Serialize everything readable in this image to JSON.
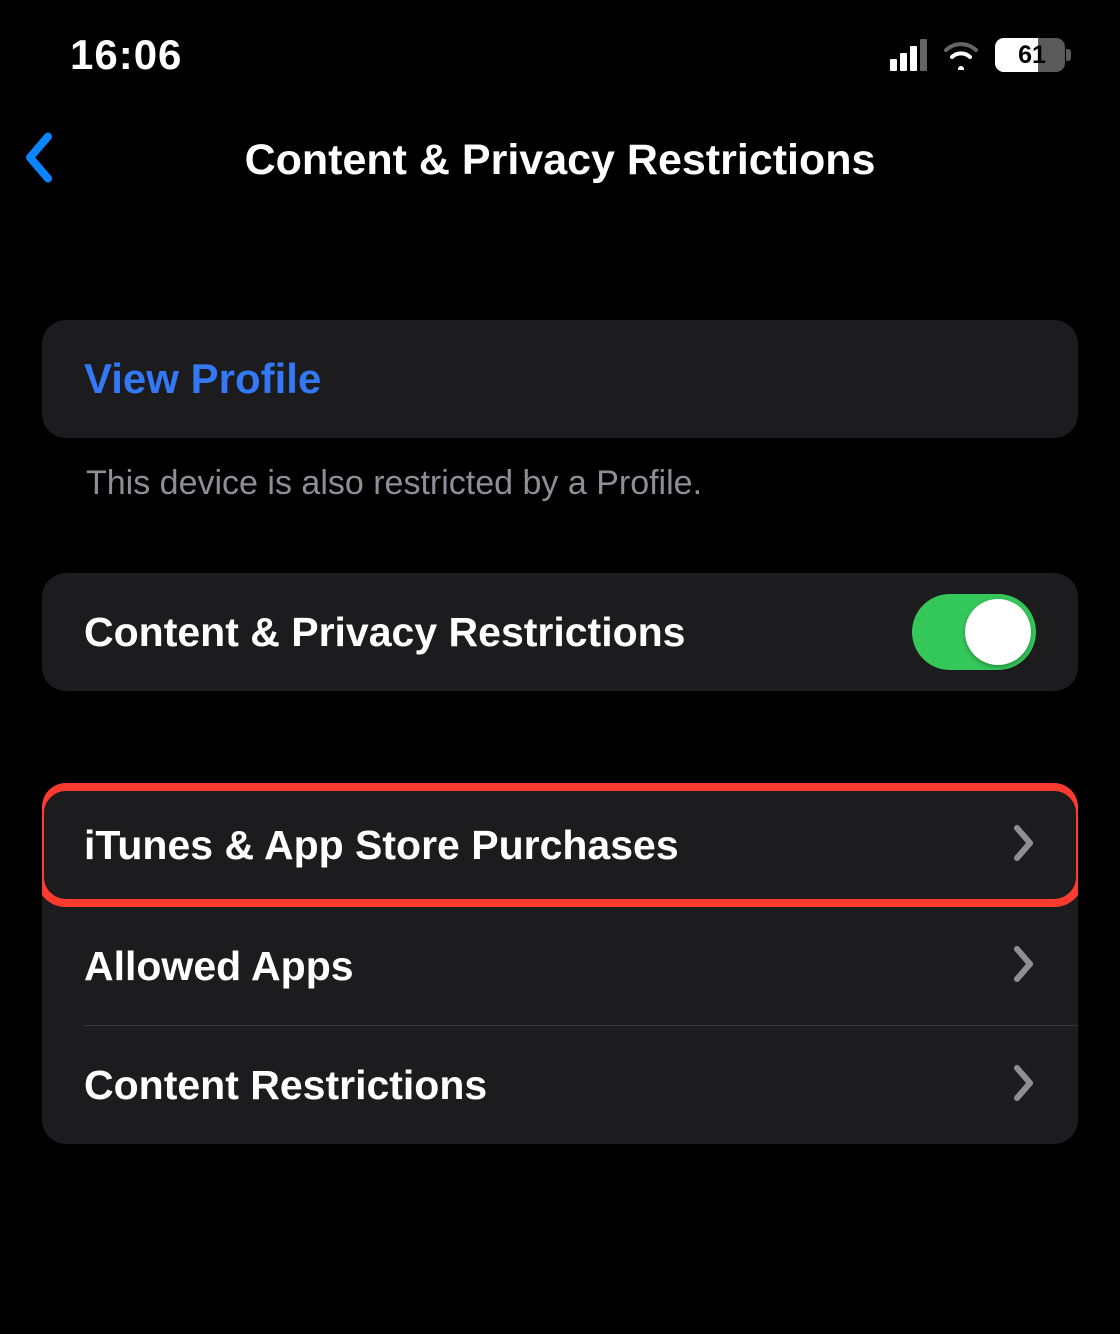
{
  "status": {
    "time": "16:06",
    "battery_percent": "61"
  },
  "nav": {
    "title": "Content & Privacy Restrictions"
  },
  "profile_section": {
    "view_profile": "View Profile",
    "footer": "This device is also restricted by a Profile."
  },
  "toggle_section": {
    "label": "Content & Privacy Restrictions",
    "enabled": true
  },
  "items": {
    "itunes": "iTunes & App Store Purchases",
    "allowed_apps": "Allowed Apps",
    "content_restrictions": "Content Restrictions"
  }
}
